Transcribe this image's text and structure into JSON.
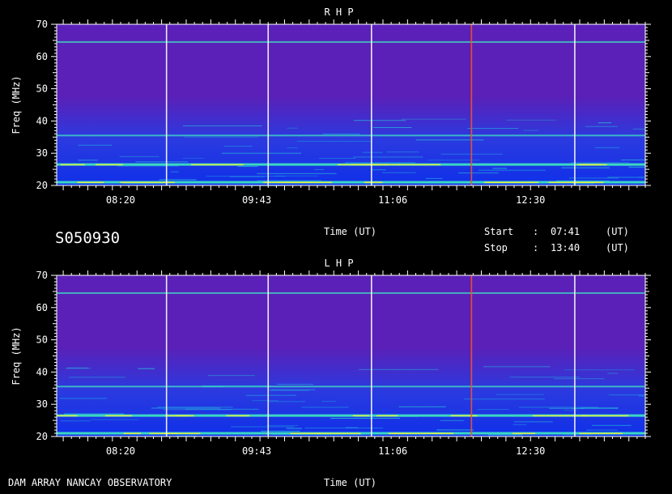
{
  "colors": {
    "background": "#5a20b8",
    "low_band": "#1030e8",
    "band": "#3de0c0",
    "hot": "#f0f040",
    "marker_white": "#ffffff",
    "marker_red": "#ff5020"
  },
  "header": {
    "id": "S050930",
    "time_label": "Time (UT)",
    "start_label": "Start",
    "start_sep": ":",
    "start_value": "07:41",
    "start_unit": "(UT)",
    "stop_label": "Stop",
    "stop_sep": ":",
    "stop_value": "13:40",
    "stop_unit": "(UT)"
  },
  "footer": {
    "observatory": "DAM ARRAY  NANCAY OBSERVATORY",
    "time_label": "Time (UT)"
  },
  "chart_data": [
    {
      "type": "heatmap",
      "title": "R H P",
      "ylabel": "Freq (MHz)",
      "xlabel": "",
      "xlim": [
        "07:41",
        "13:40"
      ],
      "ylim": [
        20,
        70
      ],
      "x_ticks": [
        "08:20",
        "09:43",
        "11:06",
        "12:30"
      ],
      "y_ticks": [
        20,
        30,
        40,
        50,
        60,
        70
      ],
      "markers": [
        {
          "time": "08:48",
          "color": "white"
        },
        {
          "time": "09:50",
          "color": "white"
        },
        {
          "time": "10:53",
          "color": "white"
        },
        {
          "time": "11:54",
          "color": "red"
        },
        {
          "time": "12:57",
          "color": "white"
        }
      ],
      "bands": [
        {
          "freq": 21.0,
          "intensity": "high"
        },
        {
          "freq": 26.5,
          "intensity": "high"
        },
        {
          "freq": 35.5,
          "intensity": "medium"
        },
        {
          "freq": 64.5,
          "intensity": "medium"
        }
      ]
    },
    {
      "type": "heatmap",
      "title": "L H P",
      "ylabel": "Freq (MHz)",
      "xlabel": "",
      "xlim": [
        "07:41",
        "13:40"
      ],
      "ylim": [
        20,
        70
      ],
      "x_ticks": [
        "08:20",
        "09:43",
        "11:06",
        "12:30"
      ],
      "y_ticks": [
        20,
        30,
        40,
        50,
        60,
        70
      ],
      "markers": [
        {
          "time": "08:48",
          "color": "white"
        },
        {
          "time": "09:50",
          "color": "white"
        },
        {
          "time": "10:53",
          "color": "white"
        },
        {
          "time": "11:54",
          "color": "red"
        },
        {
          "time": "12:57",
          "color": "white"
        }
      ],
      "bands": [
        {
          "freq": 21.0,
          "intensity": "high"
        },
        {
          "freq": 26.5,
          "intensity": "high"
        },
        {
          "freq": 35.5,
          "intensity": "medium"
        },
        {
          "freq": 64.5,
          "intensity": "medium"
        }
      ]
    }
  ]
}
